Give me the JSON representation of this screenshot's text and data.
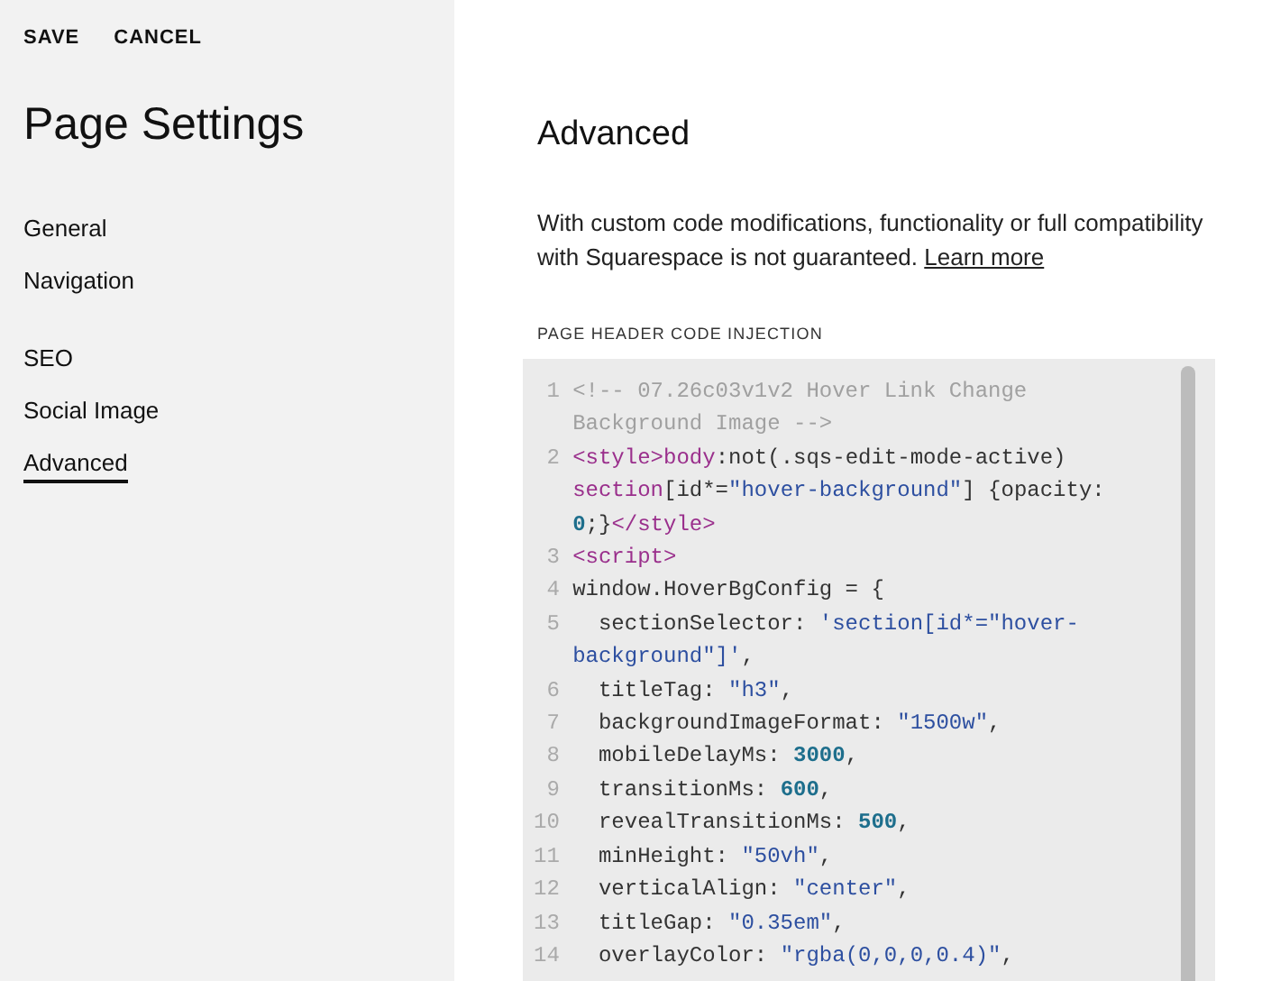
{
  "actions": [
    "SAVE",
    "CANCEL"
  ],
  "sidebar": {
    "title": "Page Settings",
    "groups": [
      {
        "items": [
          {
            "label": "General",
            "selected": false
          },
          {
            "label": "Navigation",
            "selected": false
          }
        ]
      },
      {
        "items": [
          {
            "label": "SEO",
            "selected": false
          },
          {
            "label": "Social Image",
            "selected": false
          },
          {
            "label": "Advanced",
            "selected": true
          }
        ]
      }
    ]
  },
  "main": {
    "heading": "Advanced",
    "intro": {
      "text": "With custom code modifications, functionality or full compatibility with Squarespace is not guaranteed.",
      "link": "Learn more"
    },
    "section_label": "PAGE HEADER CODE INJECTION",
    "code_lines": [
      {
        "number": "1",
        "tokens": [
          {
            "kind": "comment",
            "text": "<!-- 07.26c03v1v2 Hover Link Change Background Image -->"
          }
        ]
      },
      {
        "number": "2",
        "tokens": [
          {
            "kind": "tag",
            "text": "<style>"
          },
          {
            "kind": "tag",
            "text": "body"
          },
          {
            "kind": "plain",
            "text": ":not(.sqs-edit-mode-active) "
          },
          {
            "kind": "tag",
            "text": "section"
          },
          {
            "kind": "plain",
            "text": "[id*="
          },
          {
            "kind": "string",
            "text": "\"hover-background\""
          },
          {
            "kind": "plain",
            "text": "] {opacity: "
          },
          {
            "kind": "number",
            "text": "0"
          },
          {
            "kind": "plain",
            "text": ";}"
          },
          {
            "kind": "tag",
            "text": "</style>"
          }
        ]
      },
      {
        "number": "3",
        "tokens": [
          {
            "kind": "tag",
            "text": "<script>"
          }
        ]
      },
      {
        "number": "4",
        "tokens": [
          {
            "kind": "plain",
            "text": "window.HoverBgConfig = {"
          }
        ]
      },
      {
        "number": "5",
        "tokens": [
          {
            "kind": "plain",
            "text": "  sectionSelector: "
          },
          {
            "kind": "string",
            "text": "'section[id*=\"hover-background\"]'"
          },
          {
            "kind": "plain",
            "text": ","
          }
        ]
      },
      {
        "number": "6",
        "tokens": [
          {
            "kind": "plain",
            "text": "  titleTag: "
          },
          {
            "kind": "string",
            "text": "\"h3\""
          },
          {
            "kind": "plain",
            "text": ","
          }
        ]
      },
      {
        "number": "7",
        "tokens": [
          {
            "kind": "plain",
            "text": "  backgroundImageFormat: "
          },
          {
            "kind": "string",
            "text": "\"1500w\""
          },
          {
            "kind": "plain",
            "text": ","
          }
        ]
      },
      {
        "number": "8",
        "tokens": [
          {
            "kind": "plain",
            "text": "  mobileDelayMs: "
          },
          {
            "kind": "number",
            "text": "3000"
          },
          {
            "kind": "plain",
            "text": ","
          }
        ]
      },
      {
        "number": "9",
        "tokens": [
          {
            "kind": "plain",
            "text": "  transitionMs: "
          },
          {
            "kind": "number",
            "text": "600"
          },
          {
            "kind": "plain",
            "text": ","
          }
        ]
      },
      {
        "number": "10",
        "tokens": [
          {
            "kind": "plain",
            "text": "  revealTransitionMs: "
          },
          {
            "kind": "number",
            "text": "500"
          },
          {
            "kind": "plain",
            "text": ","
          }
        ]
      },
      {
        "number": "11",
        "tokens": [
          {
            "kind": "plain",
            "text": "  minHeight: "
          },
          {
            "kind": "string",
            "text": "\"50vh\""
          },
          {
            "kind": "plain",
            "text": ","
          }
        ]
      },
      {
        "number": "12",
        "tokens": [
          {
            "kind": "plain",
            "text": "  verticalAlign: "
          },
          {
            "kind": "string",
            "text": "\"center\""
          },
          {
            "kind": "plain",
            "text": ","
          }
        ]
      },
      {
        "number": "13",
        "tokens": [
          {
            "kind": "plain",
            "text": "  titleGap: "
          },
          {
            "kind": "string",
            "text": "\"0.35em\""
          },
          {
            "kind": "plain",
            "text": ","
          }
        ]
      },
      {
        "number": "14",
        "tokens": [
          {
            "kind": "plain",
            "text": "  overlayColor: "
          },
          {
            "kind": "string",
            "text": "\"rgba(0,0,0,0.4)\""
          },
          {
            "kind": "plain",
            "text": ","
          }
        ]
      }
    ]
  }
}
